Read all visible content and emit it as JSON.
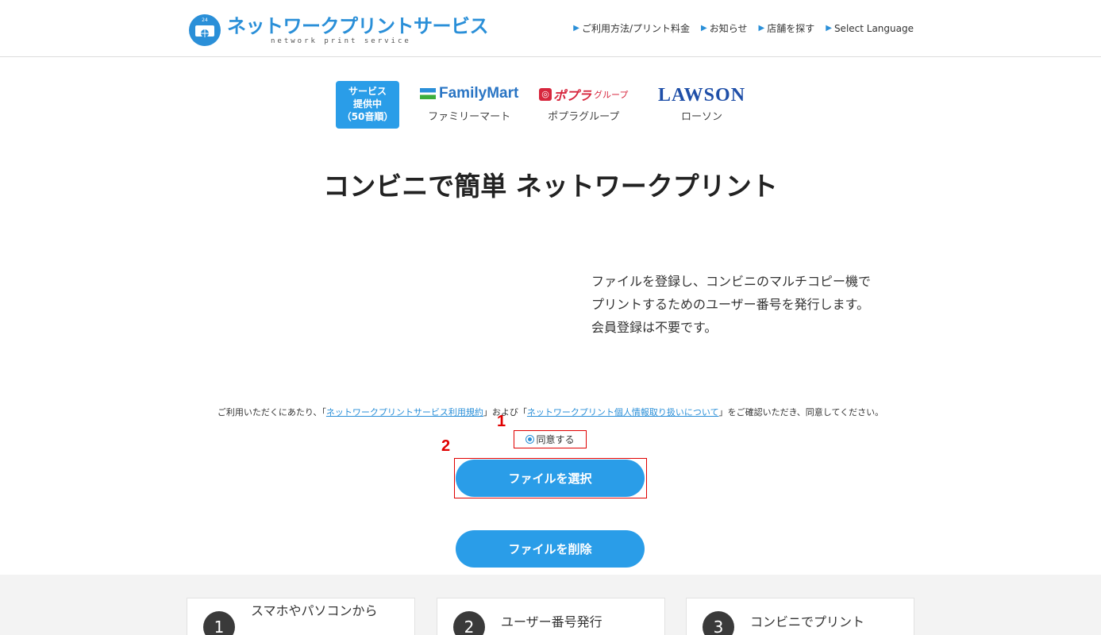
{
  "header": {
    "logo_title": "ネットワークプリントサービス",
    "logo_sub": "network print service",
    "logo_badge": "24",
    "nav": [
      {
        "label": "ご利用方法/プリント料金"
      },
      {
        "label": "お知らせ"
      },
      {
        "label": "店舗を探す"
      },
      {
        "label": "Select Language"
      }
    ]
  },
  "stores": {
    "badge_lines": [
      "サービス",
      "提供中",
      "（50音順）"
    ],
    "familymart": {
      "logo": "FamilyMart",
      "label": "ファミリーマート"
    },
    "poplar": {
      "logo": "ポプラ",
      "logo_group": "グループ",
      "label": "ポプラグループ"
    },
    "lawson": {
      "logo": "LAWSON",
      "label": "ローソン"
    }
  },
  "main": {
    "title": "コンビニで簡単 ネットワークプリント",
    "intro": [
      "ファイルを登録し、コンビニのマルチコピー機で",
      "プリントするためのユーザー番号を発行します。",
      "会員登録は不要です。"
    ],
    "terms": {
      "prefix": "ご利用いただくにあたり、「",
      "link1": "ネットワークプリントサービス利用規約",
      "mid": "」および「",
      "link2": "ネットワークプリント個人情報取り扱いについて",
      "suffix": "」をご確認いただき、同意してください。"
    },
    "agree_label": "同意する",
    "annotation_1": "1",
    "annotation_2": "2",
    "select_button": "ファイルを選択",
    "delete_button": "ファイルを削除"
  },
  "steps": [
    {
      "num": "1",
      "text": "スマホやパソコンから"
    },
    {
      "num": "2",
      "text": "ユーザー番号発行"
    },
    {
      "num": "3",
      "text": "コンビニでプリント"
    }
  ],
  "colors": {
    "brand_blue": "#2a9de8",
    "annotation_red": "#e00000"
  }
}
